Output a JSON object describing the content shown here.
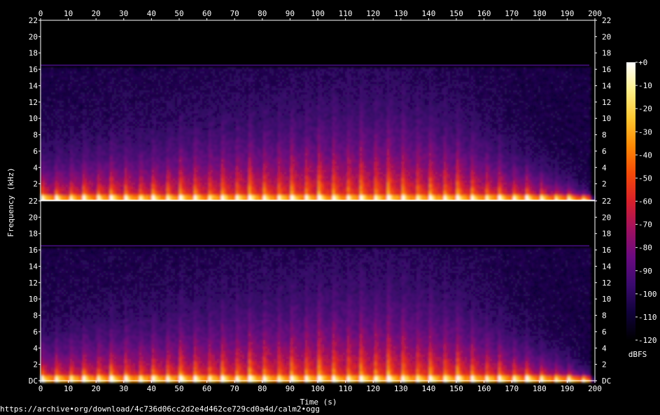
{
  "chart_data": {
    "type": "heatmap",
    "subtype": "spectrogram",
    "channels": 2,
    "xlabel": "Time (s)",
    "ylabel": "Frequency (kHz)",
    "xlim": [
      0,
      200
    ],
    "ylim": [
      0,
      22
    ],
    "x_ticks": [
      "0",
      "10",
      "20",
      "30",
      "40",
      "50",
      "60",
      "70",
      "80",
      "90",
      "100",
      "110",
      "120",
      "130",
      "140",
      "150",
      "160",
      "170",
      "180",
      "190",
      "200"
    ],
    "y_ticks": [
      {
        "value": 0,
        "label": "DC"
      },
      {
        "value": 2,
        "label": "2"
      },
      {
        "value": 4,
        "label": "4"
      },
      {
        "value": 6,
        "label": "6"
      },
      {
        "value": 8,
        "label": "8"
      },
      {
        "value": 10,
        "label": "10"
      },
      {
        "value": 12,
        "label": "12"
      },
      {
        "value": 14,
        "label": "14"
      },
      {
        "value": 16,
        "label": "16"
      },
      {
        "value": 18,
        "label": "18"
      },
      {
        "value": 20,
        "label": "20"
      },
      {
        "value": 22,
        "label": "22"
      }
    ],
    "colorbar": {
      "label": "dBFS",
      "range": [
        -120,
        0
      ],
      "ticks": [
        "+0",
        "-10",
        "-20",
        "-30",
        "-40",
        "-50",
        "-60",
        "-70",
        "-80",
        "-90",
        "-100",
        "-110",
        "-120"
      ],
      "colors": [
        "#000000",
        "#10023a",
        "#3a0a6e",
        "#6a0a80",
        "#a0105f",
        "#d8202a",
        "#f44a08",
        "#fd8a05",
        "#fdc832",
        "#fff08a",
        "#ffffff"
      ]
    },
    "lowpass_cutoff_khz": 16.5,
    "energy_envelope": {
      "time_s": [
        0,
        10,
        20,
        30,
        40,
        50,
        60,
        70,
        80,
        90,
        100,
        110,
        120,
        130,
        140,
        150,
        160,
        170,
        180,
        190,
        198
      ],
      "bright_top_khz": [
        4.5,
        5.5,
        6,
        6.5,
        6.5,
        7.5,
        8,
        8.5,
        9,
        9.5,
        10,
        10.5,
        10.5,
        10.5,
        9.5,
        8.5,
        7,
        5,
        3.5,
        2,
        0.5
      ]
    },
    "note_period_s": 5
  },
  "source_url": "https://archive•org/download/4c736d06cc2d2e4d462ce729cd0a4d/calm2•ogg"
}
